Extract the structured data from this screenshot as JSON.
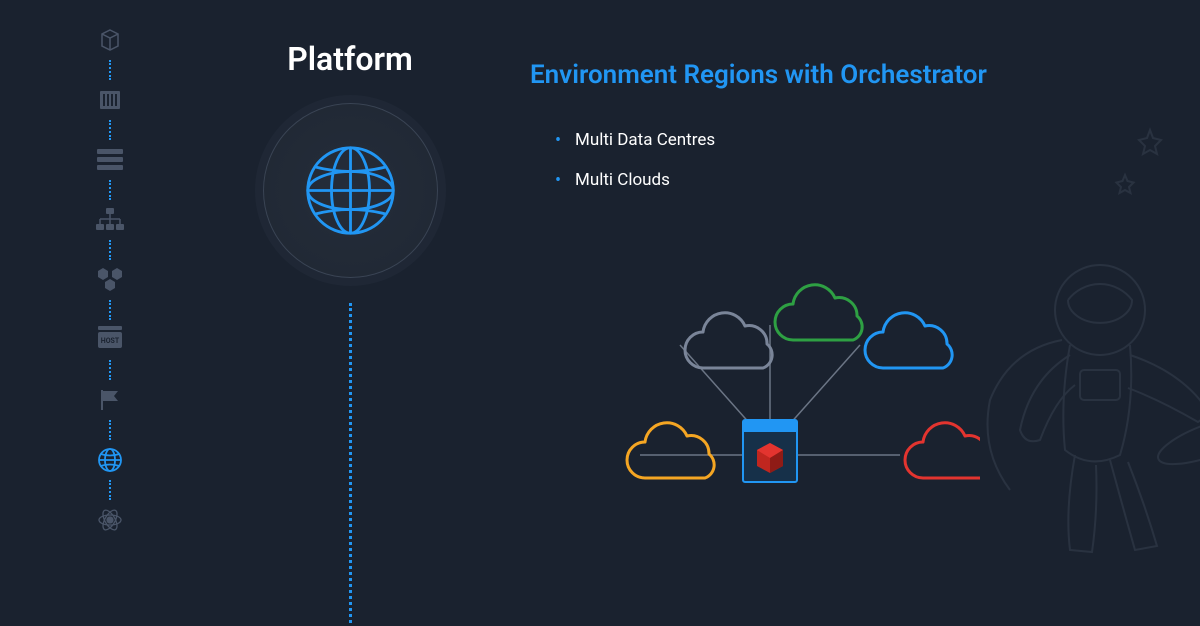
{
  "sidebar": {
    "items": [
      {
        "name": "box-icon",
        "active": false
      },
      {
        "name": "container-icon",
        "active": false
      },
      {
        "name": "layers-icon",
        "active": false
      },
      {
        "name": "network-icon",
        "active": false
      },
      {
        "name": "hexagons-icon",
        "active": false
      },
      {
        "name": "host-icon",
        "label": "HOST",
        "active": false
      },
      {
        "name": "flag-icon",
        "active": false
      },
      {
        "name": "globe-icon",
        "active": true
      },
      {
        "name": "atom-icon",
        "active": false
      }
    ]
  },
  "platform": {
    "title": "Platform",
    "icon": "globe"
  },
  "content": {
    "title": "Environment Regions with Orchestrator",
    "bullets": [
      "Multi Data Centres",
      "Multi Clouds"
    ]
  },
  "diagram": {
    "central": "orchestrator-box",
    "clouds": [
      {
        "color": "#7a8599",
        "position": "top-left"
      },
      {
        "color": "#2ea043",
        "position": "top"
      },
      {
        "color": "#2196f3",
        "position": "top-right"
      },
      {
        "color": "#f5a623",
        "position": "bottom-left"
      },
      {
        "color": "#e3342f",
        "position": "bottom-right"
      }
    ]
  },
  "colors": {
    "accent": "#2196f3",
    "background": "#1a222f",
    "muted": "#4a5568"
  }
}
